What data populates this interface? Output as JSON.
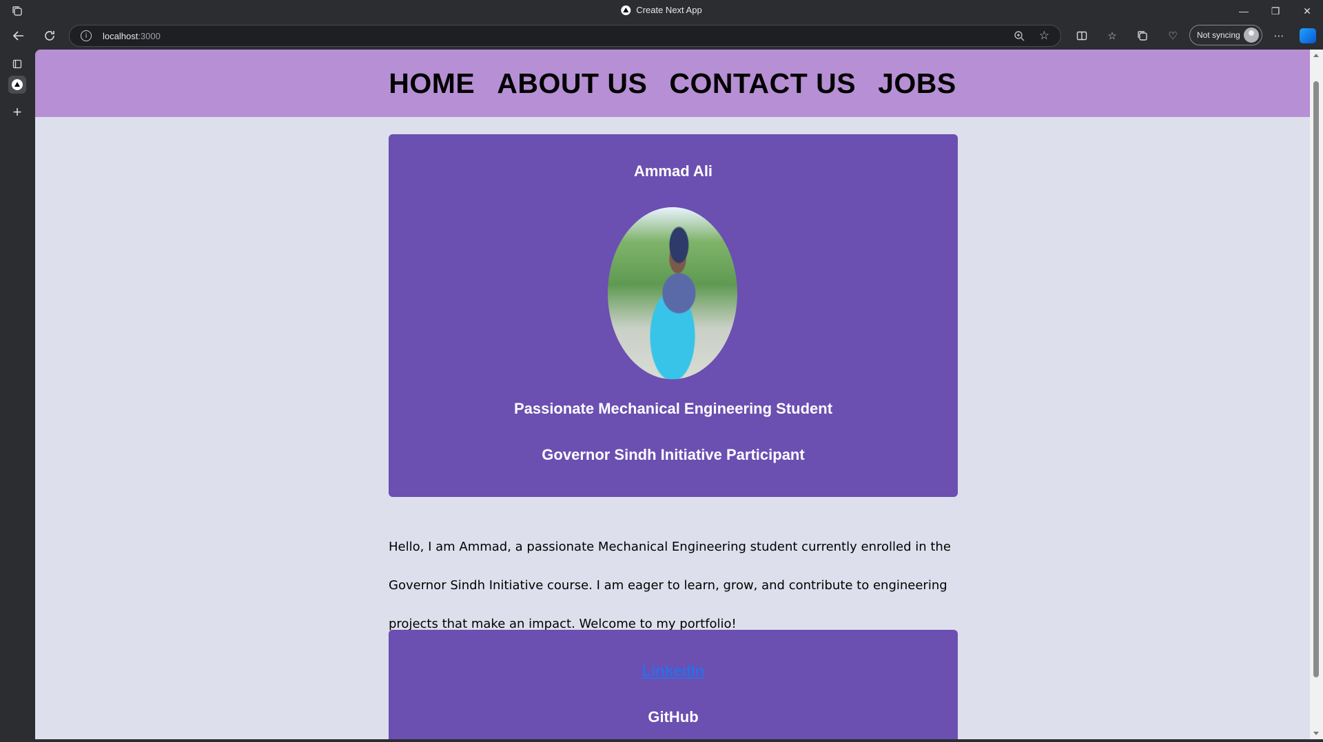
{
  "browser": {
    "tab_title": "Create Next App",
    "url_host": "localhost",
    "url_port": ":3000",
    "sync_label": "Not syncing"
  },
  "nav": {
    "items": [
      "HOME",
      "ABOUT US",
      "CONTACT US",
      "JOBS"
    ]
  },
  "profile": {
    "name": "Ammad Ali",
    "headline_1": "Passionate Mechanical Engineering Student",
    "headline_2": "Governor Sindh Initiative Participant"
  },
  "bio": "Hello, I am Ammad, a passionate Mechanical Engineering student currently enrolled in the Governor Sindh Initiative course. I am eager to learn, grow, and contribute to engineering projects that make an impact. Welcome to my portfolio!",
  "links": {
    "linkedin": "LinkedIn",
    "github": "GitHub"
  },
  "colors": {
    "navbar": "#b78fd4",
    "card": "#6b4fb1",
    "page_bg": "#dde0ec",
    "link": "#2b6fe6"
  }
}
